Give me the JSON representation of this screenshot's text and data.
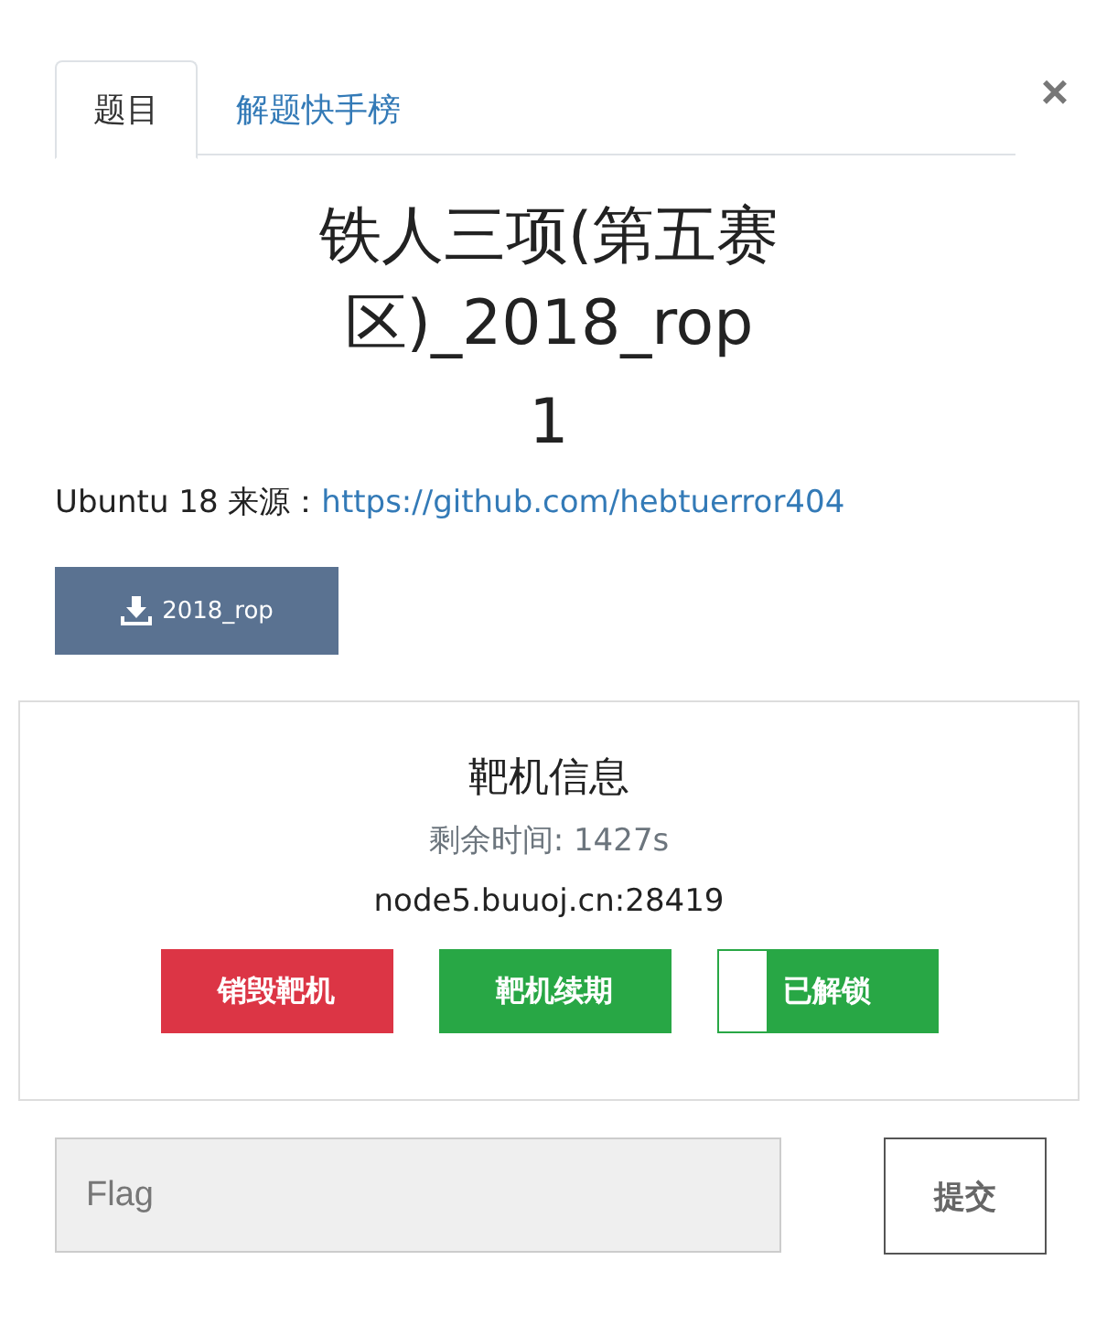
{
  "tabs": [
    {
      "label": "题目",
      "selected": true
    },
    {
      "label": "解题快手榜",
      "selected": false
    }
  ],
  "close": "×",
  "challenge": {
    "title": "铁人三项(第五赛区)_2018_rop",
    "score": "1",
    "description": "Ubuntu 18 来源：",
    "link": "https://github.com/hebtuerror404",
    "download": "2018_rop"
  },
  "target": {
    "heading": "靶机信息",
    "remaining": "剩余时间: 1427s",
    "address": "node5.buuoj.cn:28419",
    "buttons": [
      {
        "label": "销毁靶机",
        "color": "#dc3545"
      },
      {
        "label": "靶机续期",
        "color": "#28a745"
      },
      {
        "label": "已解锁",
        "color": "#28a745",
        "level": 0.78
      }
    ]
  },
  "flag": {
    "placeholder": "Flag",
    "submit": "提交"
  }
}
